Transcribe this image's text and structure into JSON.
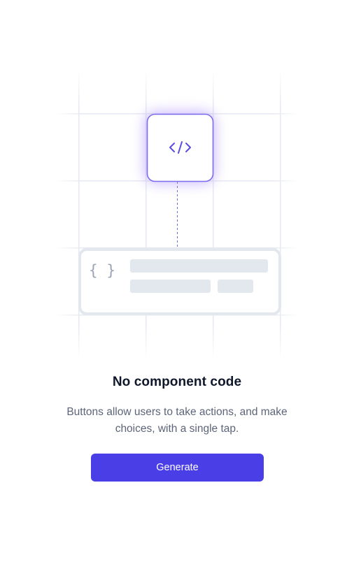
{
  "empty_state": {
    "title": "No component code",
    "description": "Buttons allow users to take actions, and make choices, with a single tap.",
    "button_label": "Generate",
    "code_icon_glyph": "</>",
    "braces_icon_glyph": "{ }",
    "icon_names": [
      "code-icon",
      "braces-icon"
    ]
  },
  "colors": {
    "accent": "#4a3fe6",
    "icon_purple": "#5b4ce0",
    "glow": "#a78bfa",
    "grid_line": "#e5e8f0",
    "skeleton": "#e3e8ef",
    "title_text": "#0f172a",
    "body_text": "#5b6478"
  }
}
